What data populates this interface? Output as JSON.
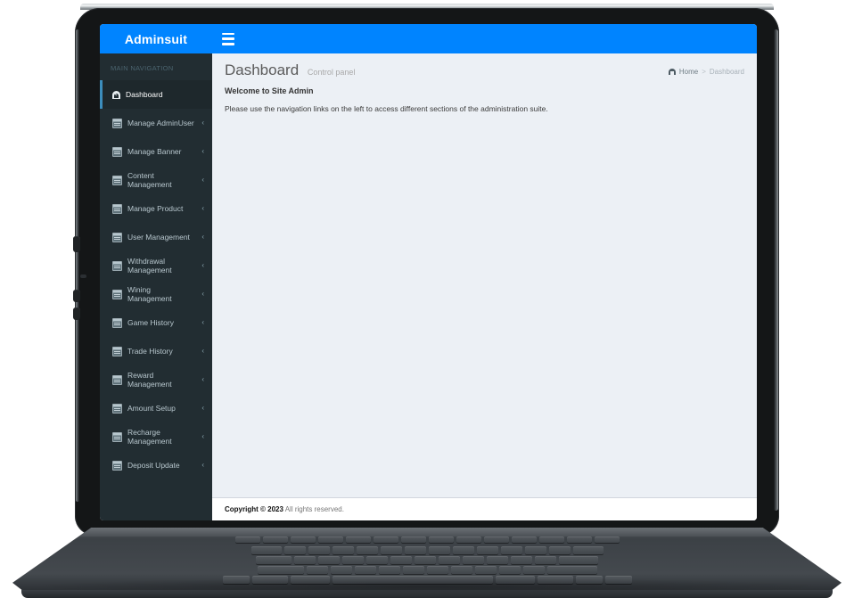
{
  "navbar": {
    "brand": "Adminsuit",
    "menu_toggle_icon": "hamburger-icon"
  },
  "sidebar": {
    "section_header": "MAIN NAVIGATION",
    "items": [
      {
        "label": "Dashboard",
        "icon": "dashboard-icon",
        "active": true,
        "has_chevron": false,
        "chevron": ""
      },
      {
        "label": "Manage AdminUser",
        "icon": "table-icon",
        "active": false,
        "has_chevron": true,
        "chevron": "‹"
      },
      {
        "label": "Manage Banner",
        "icon": "table-icon",
        "active": false,
        "has_chevron": true,
        "chevron": "‹"
      },
      {
        "label": "Content Management",
        "icon": "table-icon",
        "active": false,
        "has_chevron": true,
        "chevron": "‹"
      },
      {
        "label": "Manage Product",
        "icon": "table-icon",
        "active": false,
        "has_chevron": true,
        "chevron": "‹"
      },
      {
        "label": "User Management",
        "icon": "table-icon",
        "active": false,
        "has_chevron": true,
        "chevron": "‹"
      },
      {
        "label": "Withdrawal Management",
        "icon": "table-icon",
        "active": false,
        "has_chevron": true,
        "chevron": "‹"
      },
      {
        "label": "Wining Management",
        "icon": "table-icon",
        "active": false,
        "has_chevron": true,
        "chevron": "‹"
      },
      {
        "label": "Game History",
        "icon": "table-icon",
        "active": false,
        "has_chevron": true,
        "chevron": "‹"
      },
      {
        "label": "Trade History",
        "icon": "table-icon",
        "active": false,
        "has_chevron": true,
        "chevron": "‹"
      },
      {
        "label": "Reward Management",
        "icon": "table-icon",
        "active": false,
        "has_chevron": true,
        "chevron": "‹"
      },
      {
        "label": "Amount Setup",
        "icon": "table-icon",
        "active": false,
        "has_chevron": true,
        "chevron": "‹"
      },
      {
        "label": "Recharge Management",
        "icon": "table-icon",
        "active": false,
        "has_chevron": true,
        "chevron": "‹"
      },
      {
        "label": "Deposit Update",
        "icon": "table-icon",
        "active": false,
        "has_chevron": true,
        "chevron": "‹"
      }
    ]
  },
  "page": {
    "title": "Dashboard",
    "subtitle": "Control panel",
    "welcome_heading": "Welcome to Site Admin",
    "lead_text": "Please use the navigation links on the left to access different sections of the administration suite."
  },
  "breadcrumb": {
    "home_icon": "home-icon",
    "home_label": "Home",
    "separator": ">",
    "current": "Dashboard"
  },
  "footer": {
    "copyright": "Copyright © 2023",
    "rights": "All rights reserved."
  },
  "colors": {
    "navbar_blue": "#0084ff",
    "sidebar_dark": "#222d32",
    "sidebar_active": "#1e282c",
    "sidebar_active_bar": "#3c8dbc",
    "content_bg": "#ecf0f5",
    "sidebar_text": "#b8c7ce"
  }
}
